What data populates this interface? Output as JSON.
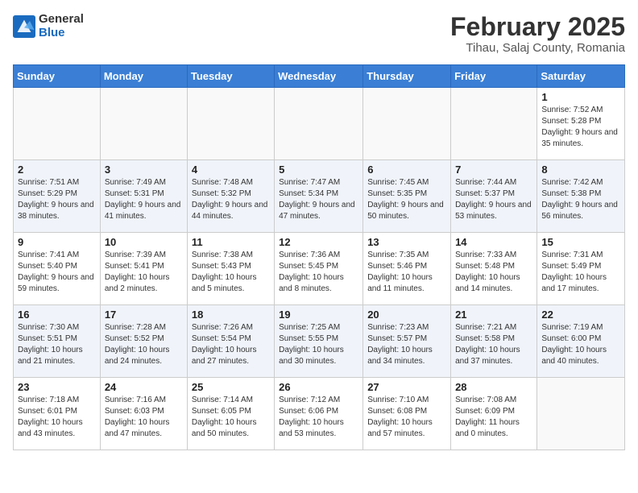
{
  "header": {
    "logo_general": "General",
    "logo_blue": "Blue",
    "month_title": "February 2025",
    "location": "Tihau, Salaj County, Romania"
  },
  "weekdays": [
    "Sunday",
    "Monday",
    "Tuesday",
    "Wednesday",
    "Thursday",
    "Friday",
    "Saturday"
  ],
  "weeks": [
    [
      {
        "day": "",
        "info": ""
      },
      {
        "day": "",
        "info": ""
      },
      {
        "day": "",
        "info": ""
      },
      {
        "day": "",
        "info": ""
      },
      {
        "day": "",
        "info": ""
      },
      {
        "day": "",
        "info": ""
      },
      {
        "day": "1",
        "info": "Sunrise: 7:52 AM\nSunset: 5:28 PM\nDaylight: 9 hours and 35 minutes."
      }
    ],
    [
      {
        "day": "2",
        "info": "Sunrise: 7:51 AM\nSunset: 5:29 PM\nDaylight: 9 hours and 38 minutes."
      },
      {
        "day": "3",
        "info": "Sunrise: 7:49 AM\nSunset: 5:31 PM\nDaylight: 9 hours and 41 minutes."
      },
      {
        "day": "4",
        "info": "Sunrise: 7:48 AM\nSunset: 5:32 PM\nDaylight: 9 hours and 44 minutes."
      },
      {
        "day": "5",
        "info": "Sunrise: 7:47 AM\nSunset: 5:34 PM\nDaylight: 9 hours and 47 minutes."
      },
      {
        "day": "6",
        "info": "Sunrise: 7:45 AM\nSunset: 5:35 PM\nDaylight: 9 hours and 50 minutes."
      },
      {
        "day": "7",
        "info": "Sunrise: 7:44 AM\nSunset: 5:37 PM\nDaylight: 9 hours and 53 minutes."
      },
      {
        "day": "8",
        "info": "Sunrise: 7:42 AM\nSunset: 5:38 PM\nDaylight: 9 hours and 56 minutes."
      }
    ],
    [
      {
        "day": "9",
        "info": "Sunrise: 7:41 AM\nSunset: 5:40 PM\nDaylight: 9 hours and 59 minutes."
      },
      {
        "day": "10",
        "info": "Sunrise: 7:39 AM\nSunset: 5:41 PM\nDaylight: 10 hours and 2 minutes."
      },
      {
        "day": "11",
        "info": "Sunrise: 7:38 AM\nSunset: 5:43 PM\nDaylight: 10 hours and 5 minutes."
      },
      {
        "day": "12",
        "info": "Sunrise: 7:36 AM\nSunset: 5:45 PM\nDaylight: 10 hours and 8 minutes."
      },
      {
        "day": "13",
        "info": "Sunrise: 7:35 AM\nSunset: 5:46 PM\nDaylight: 10 hours and 11 minutes."
      },
      {
        "day": "14",
        "info": "Sunrise: 7:33 AM\nSunset: 5:48 PM\nDaylight: 10 hours and 14 minutes."
      },
      {
        "day": "15",
        "info": "Sunrise: 7:31 AM\nSunset: 5:49 PM\nDaylight: 10 hours and 17 minutes."
      }
    ],
    [
      {
        "day": "16",
        "info": "Sunrise: 7:30 AM\nSunset: 5:51 PM\nDaylight: 10 hours and 21 minutes."
      },
      {
        "day": "17",
        "info": "Sunrise: 7:28 AM\nSunset: 5:52 PM\nDaylight: 10 hours and 24 minutes."
      },
      {
        "day": "18",
        "info": "Sunrise: 7:26 AM\nSunset: 5:54 PM\nDaylight: 10 hours and 27 minutes."
      },
      {
        "day": "19",
        "info": "Sunrise: 7:25 AM\nSunset: 5:55 PM\nDaylight: 10 hours and 30 minutes."
      },
      {
        "day": "20",
        "info": "Sunrise: 7:23 AM\nSunset: 5:57 PM\nDaylight: 10 hours and 34 minutes."
      },
      {
        "day": "21",
        "info": "Sunrise: 7:21 AM\nSunset: 5:58 PM\nDaylight: 10 hours and 37 minutes."
      },
      {
        "day": "22",
        "info": "Sunrise: 7:19 AM\nSunset: 6:00 PM\nDaylight: 10 hours and 40 minutes."
      }
    ],
    [
      {
        "day": "23",
        "info": "Sunrise: 7:18 AM\nSunset: 6:01 PM\nDaylight: 10 hours and 43 minutes."
      },
      {
        "day": "24",
        "info": "Sunrise: 7:16 AM\nSunset: 6:03 PM\nDaylight: 10 hours and 47 minutes."
      },
      {
        "day": "25",
        "info": "Sunrise: 7:14 AM\nSunset: 6:05 PM\nDaylight: 10 hours and 50 minutes."
      },
      {
        "day": "26",
        "info": "Sunrise: 7:12 AM\nSunset: 6:06 PM\nDaylight: 10 hours and 53 minutes."
      },
      {
        "day": "27",
        "info": "Sunrise: 7:10 AM\nSunset: 6:08 PM\nDaylight: 10 hours and 57 minutes."
      },
      {
        "day": "28",
        "info": "Sunrise: 7:08 AM\nSunset: 6:09 PM\nDaylight: 11 hours and 0 minutes."
      },
      {
        "day": "",
        "info": ""
      }
    ]
  ]
}
